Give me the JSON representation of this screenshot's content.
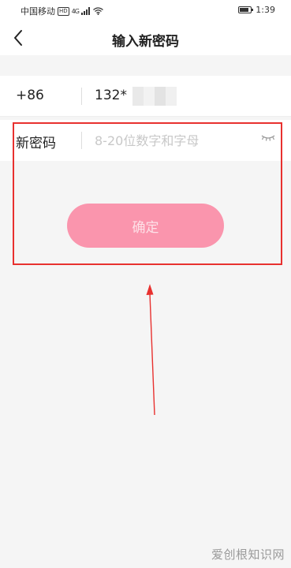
{
  "status_bar": {
    "carrier": "中国移动",
    "hd_badge": "HD",
    "network": "4G",
    "time": "1:39"
  },
  "header": {
    "title": "输入新密码",
    "back_icon": "chevron-left-icon"
  },
  "phone_row": {
    "country_code": "+86",
    "phone_number": "132*"
  },
  "password_row": {
    "label": "新密码",
    "placeholder": "8-20位数字和字母",
    "value": "",
    "toggle_icon": "eye-closed-icon"
  },
  "confirm_button": {
    "label": "确定"
  },
  "watermark": {
    "text": "爱创根知识网"
  },
  "colors": {
    "button_bg": "#fa95ad",
    "annotation": "#e8312f",
    "page_bg": "#f5f5f5"
  }
}
